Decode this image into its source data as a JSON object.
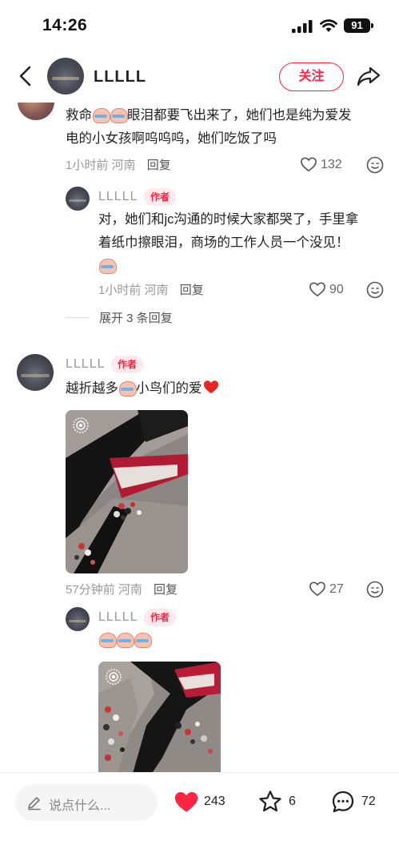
{
  "status_bar": {
    "time": "14:26",
    "battery": "91"
  },
  "nav": {
    "name": "LLLLL",
    "follow_label": "关注"
  },
  "comments": {
    "c1": {
      "text_line1": "眼泪都要飞出来了，她们也是纯为爱发",
      "text_prefix": "救命",
      "text_line2": "电的小女孩啊呜呜呜，她们吃饭了吗",
      "time": "1小时前",
      "location": "河南",
      "reply_label": "回复",
      "likes": "132"
    },
    "r1": {
      "name": "LLLLL",
      "badge": "作者",
      "text_line1": "对，她们和jc沟通的时候大家都哭了，手里拿",
      "text_line2": "着纸巾擦眼泪，商场的工作人员一个没见！",
      "time": "1小时前",
      "location": "河南",
      "reply_label": "回复",
      "likes": "90"
    },
    "expand_label": "展开 3 条回复",
    "c2": {
      "name": "LLLLL",
      "badge": "作者",
      "text_prefix": "越折越多",
      "text_suffix": "小鸟们的爱",
      "time": "57分钟前",
      "location": "河南",
      "reply_label": "回复",
      "likes": "27"
    },
    "r2": {
      "name": "LLLLL",
      "badge": "作者"
    }
  },
  "bottom": {
    "placeholder": "说点什么...",
    "likes": "243",
    "stars": "6",
    "comments": "72"
  },
  "colors": {
    "accent": "#ff2442",
    "badge_bg": "#ffe9ec"
  }
}
